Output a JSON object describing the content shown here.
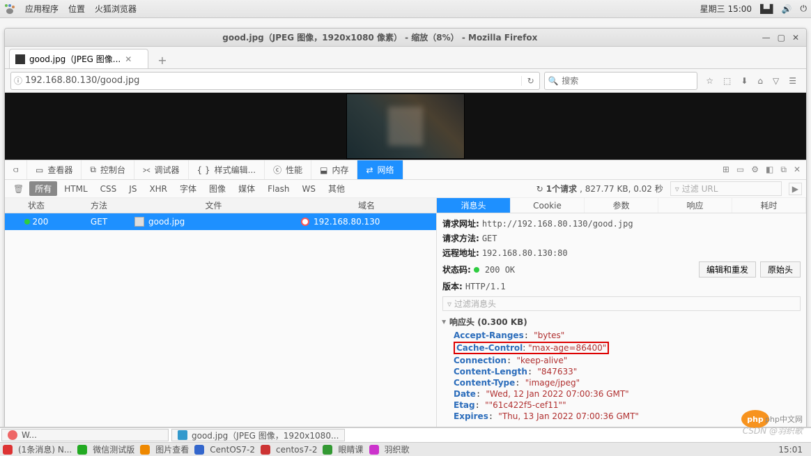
{
  "gnome": {
    "apps": "应用程序",
    "places": "位置",
    "firefox": "火狐浏览器",
    "date": "星期三 15:00"
  },
  "window": {
    "title": "good.jpg（JPEG 图像，1920x1080 像素） - 缩放（8%） - Mozilla Firefox",
    "tab_label": "good.jpg（JPEG 图像...",
    "url": "192.168.80.130/good.jpg",
    "search_placeholder": "搜索"
  },
  "devtools": {
    "tabs": {
      "inspect": "查看器",
      "console": "控制台",
      "debugger": "调试器",
      "style": "样式编辑...",
      "perf": "性能",
      "memory": "内存",
      "network": "网络"
    },
    "filters": {
      "all": "所有",
      "html": "HTML",
      "css": "CSS",
      "js": "JS",
      "xhr": "XHR",
      "font": "字体",
      "img": "图像",
      "media": "媒体",
      "flash": "Flash",
      "ws": "WS",
      "other": "其他"
    },
    "summary_pre": "1个请求",
    "summary_rest": ", 827.77 KB, 0.02 秒",
    "filter_url": "过滤 URL",
    "cols": {
      "status": "状态",
      "method": "方法",
      "file": "文件",
      "domain": "域名"
    },
    "row": {
      "status": "200",
      "method": "GET",
      "file": "good.jpg",
      "domain": "192.168.80.130"
    },
    "detail_tabs": {
      "headers": "消息头",
      "cookie": "Cookie",
      "params": "参数",
      "response": "响应",
      "timing": "耗时"
    },
    "req_url_k": "请求网址:",
    "req_url_v": "http://192.168.80.130/good.jpg",
    "req_method_k": "请求方法:",
    "req_method_v": "GET",
    "remote_k": "远程地址:",
    "remote_v": "192.168.80.130:80",
    "status_k": "状态码:",
    "status_v": "200 OK",
    "edit_resend": "编辑和重发",
    "raw": "原始头",
    "version_k": "版本:",
    "version_v": "HTTP/1.1",
    "filter_headers": "过滤消息头",
    "resp_section": "响应头 (0.300 KB)",
    "headers": [
      {
        "n": "Accept-Ranges",
        "v": "\"bytes\""
      },
      {
        "n": "Cache-Control",
        "v": "\"max-age=86400\"",
        "boxed": true
      },
      {
        "n": "Connection",
        "v": "\"keep-alive\""
      },
      {
        "n": "Content-Length",
        "v": "\"847633\""
      },
      {
        "n": "Content-Type",
        "v": "\"image/jpeg\""
      },
      {
        "n": "Date",
        "v": "\"Wed, 12 Jan 2022 07:00:36 GMT\""
      },
      {
        "n": "Etag",
        "v": "\"\"61c422f5-cef11\"\""
      },
      {
        "n": "Expires",
        "v": "\"Thu, 13 Jan 2022 07:00:36 GMT\""
      }
    ]
  },
  "taskbar": {
    "btn2_prefix": "good.jpg（JPEG 图像，1920x1080...",
    "items": [
      "(1条消息) N...",
      "微信测试版",
      "图片查看",
      "CentOS7-2",
      "centos7-2",
      "眼睛课",
      "羽织歌"
    ],
    "clock": "15:01"
  },
  "watermark": "CSDN @羽织歌",
  "phpcn": "php中文网"
}
